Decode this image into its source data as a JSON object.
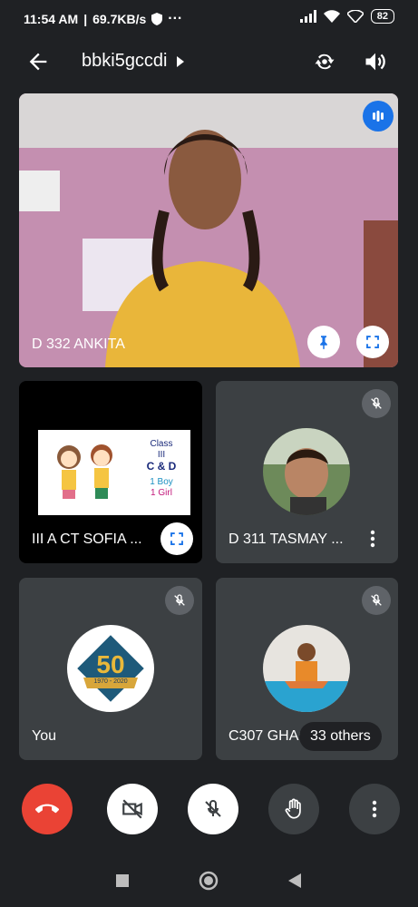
{
  "status_bar": {
    "time": "11:54 AM",
    "speed": "69.7KB/s",
    "dots": "···",
    "battery": "82"
  },
  "app_bar": {
    "meeting_code": "bbki5gccdi"
  },
  "tiles": {
    "main": {
      "name": "D 332 ANKITA"
    },
    "t1": {
      "name": "III A CT SOFIA ...",
      "slide": {
        "l1": "Class",
        "l2": "III",
        "l3": "C & D",
        "l4": "1 Boy",
        "l5": "1 Girl"
      }
    },
    "t2": {
      "name": "D 311 TASMAY ..."
    },
    "t3": {
      "name": "You",
      "logo_number": "50",
      "logo_years": "1970 - 2020"
    },
    "t4": {
      "name": "C307 GHAGRE PRA..."
    }
  },
  "others_badge": "33 others",
  "colors": {
    "end_call": "#ea4335",
    "tile_bg": "#3c4043",
    "page_bg": "#1f2124",
    "accent": "#1a73e8"
  }
}
